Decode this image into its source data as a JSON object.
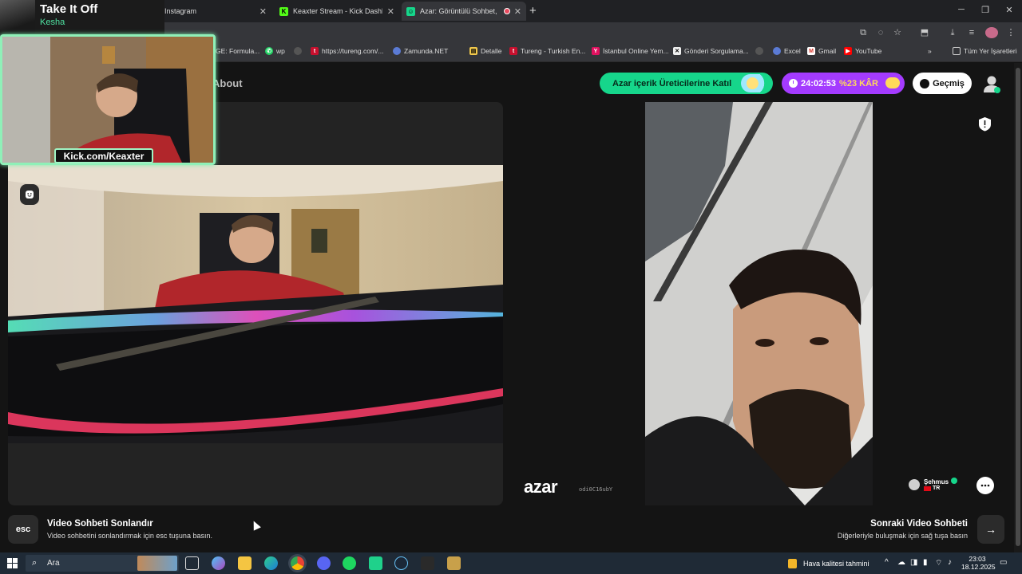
{
  "media_overlay": {
    "song_title": "Take It Off",
    "song_artist": "Kesha",
    "channel": "Kick.com/Keaxter"
  },
  "tabs": [
    {
      "label": "Instagram",
      "active": false,
      "icon": "instagram-icon"
    },
    {
      "label": "Keaxter Stream - Kick Dashboard",
      "active": false,
      "icon": "kick-icon"
    },
    {
      "label": "Azar: Görüntülü Sohbet, Yeni",
      "active": true,
      "icon": "azar-icon",
      "recording": true
    }
  ],
  "bookmarks": [
    {
      "label": "GE: Formula...",
      "icon": ""
    },
    {
      "label": "wp",
      "icon": "whatsapp-icon"
    },
    {
      "label": "",
      "icon": "globe-icon"
    },
    {
      "label": "https://tureng.com/...",
      "icon": "tureng-icon"
    },
    {
      "label": "Zamunda.NET",
      "icon": "globe-icon"
    },
    {
      "label": "Detalle",
      "icon": "bookmark-icon"
    },
    {
      "label": "Tureng - Turkish En...",
      "icon": "tureng-icon"
    },
    {
      "label": "İstanbul Online Yem...",
      "icon": "yemeksepeti-icon"
    },
    {
      "label": "Gönderi Sorgulama...",
      "icon": "x-icon"
    },
    {
      "label": "",
      "icon": "globe-icon"
    },
    {
      "label": "Excel",
      "icon": "excel-icon"
    },
    {
      "label": "Gmail",
      "icon": "gmail-icon"
    },
    {
      "label": "YouTube",
      "icon": "youtube-icon"
    }
  ],
  "all_bookmarks": "Tüm Yer İşaretleri",
  "header": {
    "about": "About",
    "creator_button": "Azar içerik Üreticilerine Katıl",
    "timer": "24:02:53",
    "discount": "%23 KÂR",
    "history_button": "Geçmiş"
  },
  "brand": {
    "logo": "azar",
    "user_id": "odi0C16ubY",
    "accent": "#16d68b",
    "purple": "#a43bff"
  },
  "peer": {
    "name": "Şehmus",
    "country": "TR"
  },
  "footer": {
    "esc_key": "esc",
    "end_title": "Video Sohbeti Sonlandır",
    "end_desc": "Video sohbetini sonlandırmak için esc tuşuna basın.",
    "next_title": "Sonraki Video Sohbeti",
    "next_desc": "Diğerleriyle buluşmak için sağ tuşa basın"
  },
  "taskbar": {
    "search_label": "Ara",
    "weather": "Hava kalitesi tahmini",
    "time": "23:03",
    "date": "18.12.2025"
  }
}
